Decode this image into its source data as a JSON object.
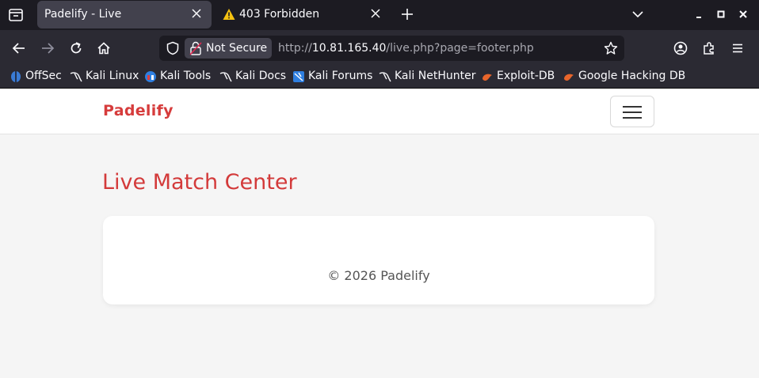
{
  "browser": {
    "tabs": [
      {
        "title": "Padelify - Live"
      },
      {
        "title": "403 Forbidden"
      }
    ],
    "url_security": "Not Secure",
    "url_scheme": "http://",
    "url_host": "10.81.165.40",
    "url_path": "/live.php?page=footer.php",
    "bookmarks": [
      {
        "label": "OffSec",
        "icon": "offsec-icon"
      },
      {
        "label": "Kali Linux",
        "icon": "kali-icon"
      },
      {
        "label": "Kali Tools",
        "icon": "kali-tools-icon"
      },
      {
        "label": "Kali Docs",
        "icon": "kali-icon"
      },
      {
        "label": "Kali Forums",
        "icon": "kali-forums-icon"
      },
      {
        "label": "Kali NetHunter",
        "icon": "kali-icon"
      },
      {
        "label": "Exploit-DB",
        "icon": "exploitdb-icon"
      },
      {
        "label": "Google Hacking DB",
        "icon": "exploitdb-icon"
      }
    ]
  },
  "site": {
    "brand": "Padelify",
    "heading": "Live Match Center",
    "footer": "© 2026 Padelify"
  },
  "colors": {
    "brand": "#d63c3c",
    "browser_dark": "#1c1b22",
    "browser_toolbar": "#2b2a33"
  }
}
